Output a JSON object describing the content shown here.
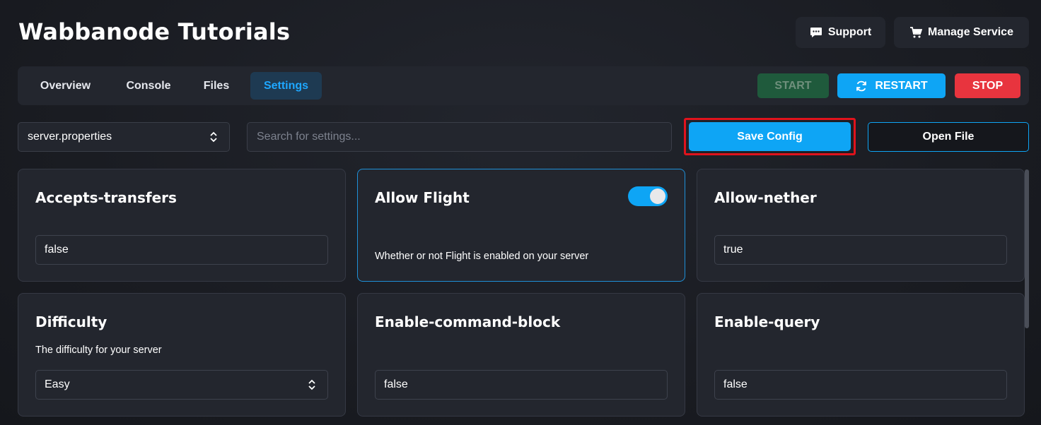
{
  "header": {
    "title": "Wabbanode Tutorials",
    "support_label": "Support",
    "manage_label": "Manage Service"
  },
  "tabs": [
    {
      "label": "Overview"
    },
    {
      "label": "Console"
    },
    {
      "label": "Files"
    },
    {
      "label": "Settings",
      "active": true
    }
  ],
  "power": {
    "start_label": "START",
    "restart_label": "RESTART",
    "stop_label": "STOP"
  },
  "toolbar": {
    "file_select_value": "server.properties",
    "search_placeholder": "Search for settings...",
    "save_label": "Save Config",
    "open_label": "Open File"
  },
  "settings": [
    {
      "title": "Accepts-transfers",
      "value": "false"
    },
    {
      "title": "Allow Flight",
      "description": "Whether or not Flight is enabled on your server",
      "toggle": true
    },
    {
      "title": "Allow-nether",
      "value": "true"
    },
    {
      "title": "Difficulty",
      "description": "The difficulty for your server",
      "value": "Easy"
    },
    {
      "title": "Enable-command-block",
      "value": "false"
    },
    {
      "title": "Enable-query",
      "value": "false"
    }
  ],
  "colors": {
    "accent": "#0ea5f5",
    "start": "#1f5a3c",
    "stop": "#e8343e",
    "highlight": "#e0131c"
  }
}
